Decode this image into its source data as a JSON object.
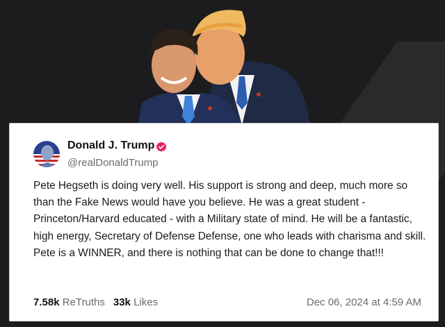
{
  "post": {
    "display_name": "Donald J. Trump",
    "handle": "@realDonaldTrump",
    "body": "Pete Hegseth is doing very well. His support is strong and deep, much more so than the Fake News would have you believe. He was a great student - Princeton/Harvard educated - with a Military state of mind. He will be a fantastic, high energy, Secretary of Defense Defense, one who leads with charisma and skill. Pete is a WINNER, and there is nothing that can be done to change that!!!",
    "retruths_count": "7.58k",
    "retruths_label": "ReTruths",
    "likes_count": "33k",
    "likes_label": "Likes",
    "timestamp": "Dec 06, 2024 at 4:59 AM",
    "verified_icon": "verified-badge-icon"
  },
  "colors": {
    "background": "#1c1c1e",
    "card": "#ffffff",
    "verified_badge": "#e0245e",
    "muted_text": "#6b6b6b"
  }
}
